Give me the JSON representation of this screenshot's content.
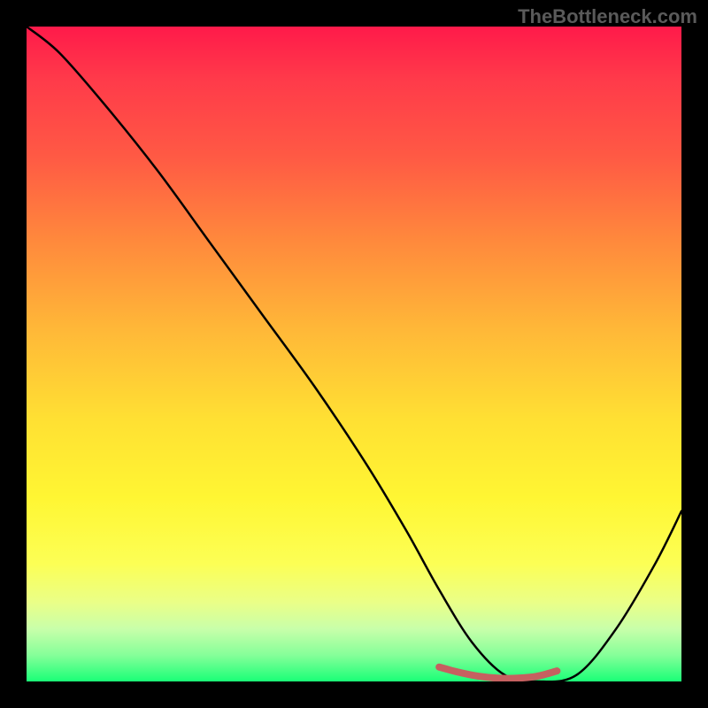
{
  "watermark": "TheBottleneck.com",
  "chart_data": {
    "type": "line",
    "title": "",
    "xlabel": "",
    "ylabel": "",
    "xlim": [
      0,
      100
    ],
    "ylim": [
      0,
      100
    ],
    "series": [
      {
        "name": "bottleneck-curve",
        "color": "#000000",
        "x": [
          0,
          5,
          12,
          20,
          28,
          36,
          44,
          52,
          58,
          63,
          68,
          73,
          78,
          84,
          90,
          96,
          100
        ],
        "values": [
          100,
          96,
          88,
          78,
          67,
          56,
          45,
          33,
          23,
          14,
          6,
          1,
          0,
          1,
          8,
          18,
          26
        ]
      },
      {
        "name": "bottleneck-trough-highlight",
        "color": "#c66060",
        "x": [
          63,
          66,
          69,
          72,
          75,
          78,
          81
        ],
        "values": [
          2.2,
          1.4,
          0.8,
          0.5,
          0.5,
          0.8,
          1.6
        ]
      }
    ],
    "gradient_stops": [
      {
        "pos": 0,
        "color": "#ff1a4a"
      },
      {
        "pos": 8,
        "color": "#ff3a4a"
      },
      {
        "pos": 20,
        "color": "#ff5a44"
      },
      {
        "pos": 33,
        "color": "#ff8a3c"
      },
      {
        "pos": 46,
        "color": "#ffb738"
      },
      {
        "pos": 60,
        "color": "#ffe033"
      },
      {
        "pos": 72,
        "color": "#fff633"
      },
      {
        "pos": 82,
        "color": "#fcff55"
      },
      {
        "pos": 88,
        "color": "#eaff88"
      },
      {
        "pos": 92,
        "color": "#c8ffaa"
      },
      {
        "pos": 96,
        "color": "#85ff99"
      },
      {
        "pos": 100,
        "color": "#1aff77"
      }
    ]
  }
}
